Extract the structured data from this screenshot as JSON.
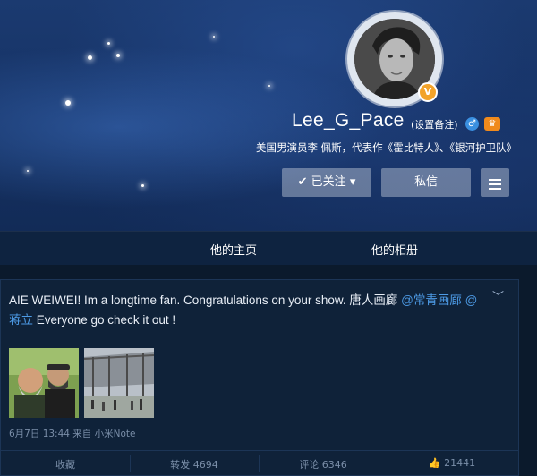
{
  "profile": {
    "name": "Lee_G_Pace",
    "remark_label": "(设置备注)",
    "verified_badge": "V",
    "gender_icon": "male-icon",
    "vip_icon": "vip-icon",
    "bio": "美国男演员李 佩斯，代表作《霍比特人》、《银河护卫队》"
  },
  "actions": {
    "follow_label": "已关注",
    "message_label": "私信",
    "menu_icon": "menu-icon"
  },
  "tabs": [
    {
      "label": "他的主页"
    },
    {
      "label": "他的相册"
    }
  ],
  "post": {
    "text_prefix": "AIE WEIWEI! Im a longtime fan. Congratulations on your show. 唐人画廊 ",
    "mention1": "@常青画廊",
    "mention2_a": "@",
    "mention2_b": "蒋立",
    "text_suffix": " Everyone go check it out !",
    "meta": "6月7日 13:44 来自 小米Note",
    "photos": [
      {
        "name": "photo-two-men"
      },
      {
        "name": "photo-gallery-interior"
      }
    ]
  },
  "post_actions": {
    "favorite": "收藏",
    "repost": "转发 4694",
    "comment": "评论 6346",
    "like": "21441"
  },
  "colors": {
    "accent": "#4d9be6",
    "banner": "#163366",
    "card": "#0f2239"
  }
}
